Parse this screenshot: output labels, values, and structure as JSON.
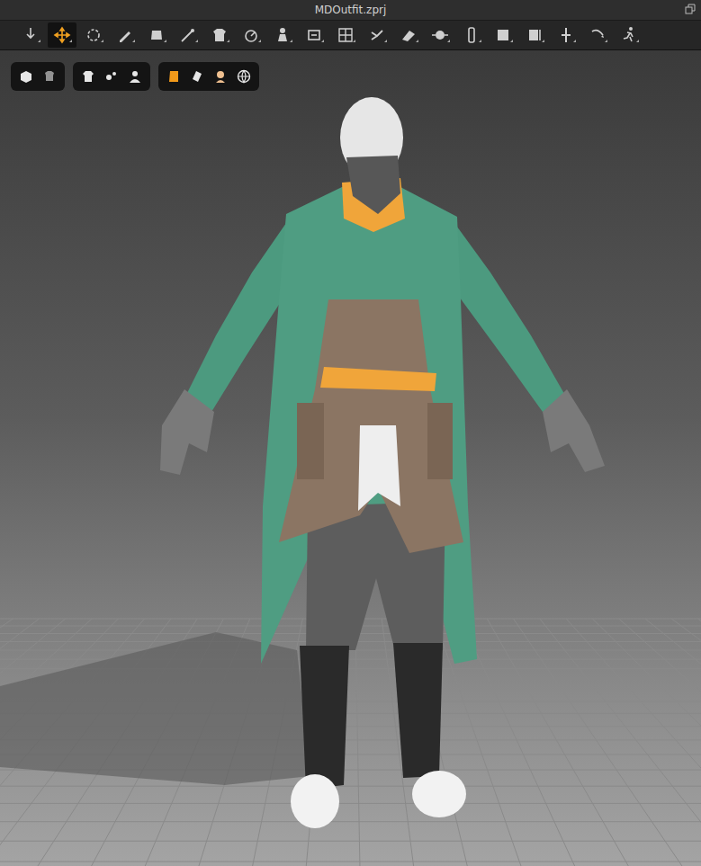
{
  "window": {
    "title": "MDOutfit.zprj"
  },
  "toolbar": {
    "tools": [
      {
        "selected": false
      },
      {
        "selected": true
      },
      {
        "selected": false
      },
      {
        "selected": false
      },
      {
        "selected": false
      },
      {
        "selected": false
      },
      {
        "selected": false
      },
      {
        "selected": false
      },
      {
        "selected": false
      },
      {
        "selected": false
      },
      {
        "selected": false
      },
      {
        "selected": false
      },
      {
        "selected": false
      },
      {
        "selected": false
      },
      {
        "selected": false
      },
      {
        "selected": false
      },
      {
        "selected": false
      },
      {
        "selected": false
      },
      {
        "selected": false
      },
      {
        "selected": false
      }
    ]
  },
  "viewport_controls": {
    "groups": [
      {
        "buttons": [
          {
            "on": false
          },
          {
            "on": false
          }
        ]
      },
      {
        "buttons": [
          {
            "on": false
          },
          {
            "on": false
          },
          {
            "on": false
          }
        ]
      },
      {
        "buttons": [
          {
            "on": true
          },
          {
            "on": false
          },
          {
            "on": false
          },
          {
            "on": false
          }
        ]
      }
    ]
  }
}
